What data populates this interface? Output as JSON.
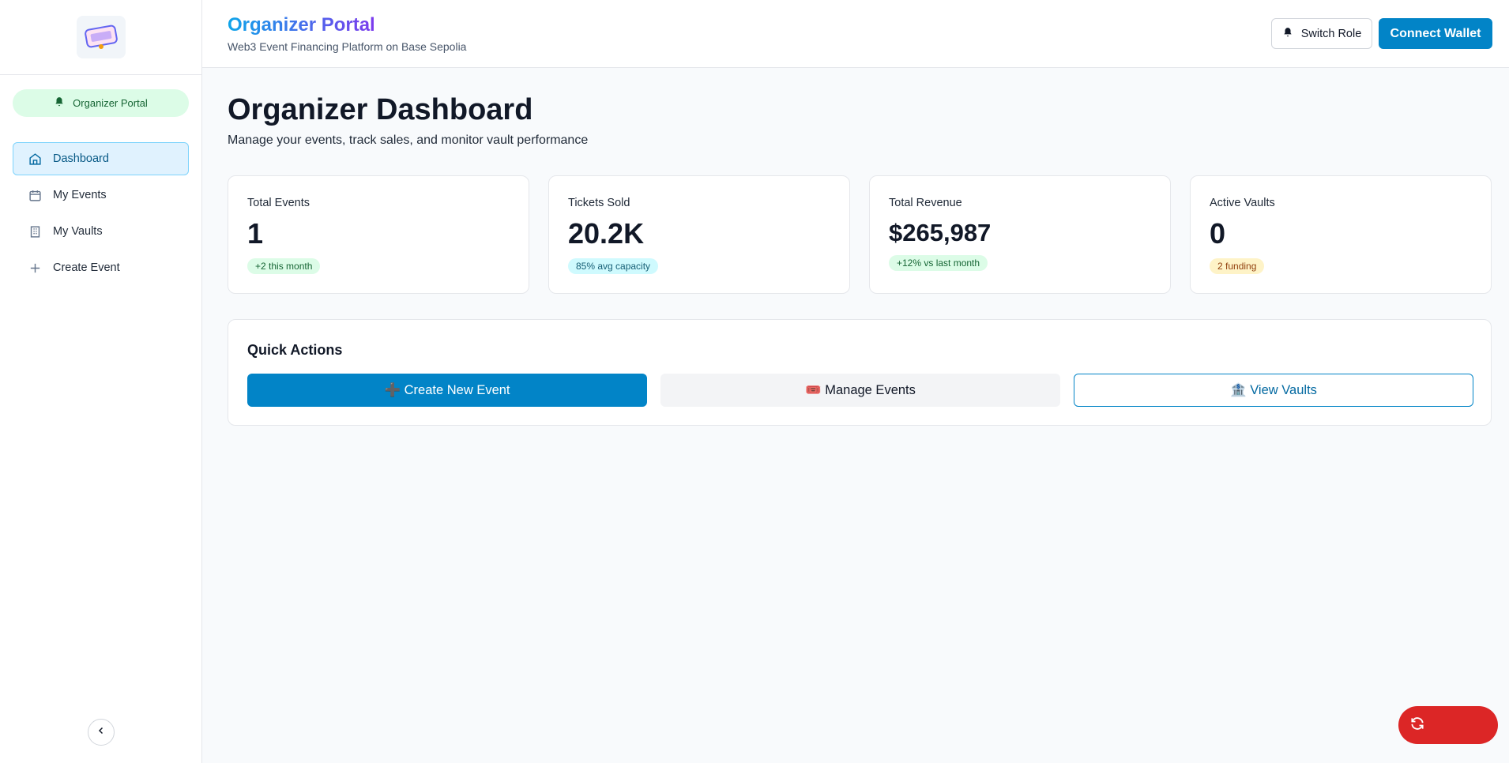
{
  "sidebar": {
    "portal_badge": "Organizer Portal",
    "items": [
      {
        "label": "Dashboard",
        "icon": "home-icon",
        "active": true
      },
      {
        "label": "My Events",
        "icon": "calendar-icon",
        "active": false
      },
      {
        "label": "My Vaults",
        "icon": "building-icon",
        "active": false
      },
      {
        "label": "Create Event",
        "icon": "plus-icon",
        "active": false
      }
    ]
  },
  "header": {
    "title": "Organizer Portal",
    "subtitle": "Web3 Event Financing Platform on Base Sepolia",
    "switch_role": "Switch Role",
    "connect_wallet": "Connect Wallet"
  },
  "main": {
    "title": "Organizer Dashboard",
    "subtitle": "Manage your events, track sales, and monitor vault performance",
    "cards": [
      {
        "label": "Total Events",
        "value": "1",
        "pill": "+2 this month"
      },
      {
        "label": "Tickets Sold",
        "value": "20.2K",
        "pill": "85% avg capacity"
      },
      {
        "label": "Total Revenue",
        "value": "$265,987",
        "pill": "+12% vs last month"
      },
      {
        "label": "Active Vaults",
        "value": "0",
        "pill": "2 funding"
      }
    ],
    "quick_actions": {
      "title": "Quick Actions",
      "create_event": "➕ Create New Event",
      "manage_events": "🎟️ Manage Events",
      "view_vaults": "🏦 View Vaults"
    }
  },
  "colors": {
    "primary": "#0284c7",
    "active_nav_bg": "#e0f2fe",
    "badge_green": "#dcfce7",
    "fab_red": "#dc2626"
  }
}
